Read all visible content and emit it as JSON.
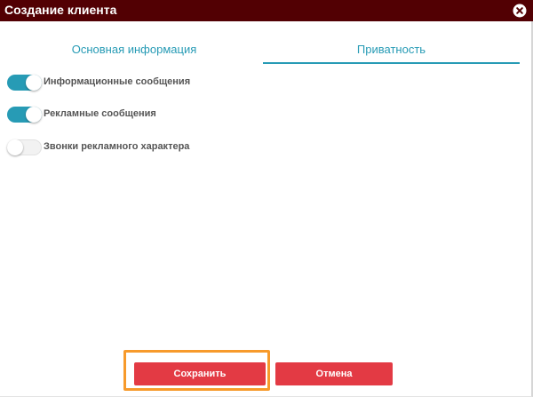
{
  "dialog": {
    "title": "Создание клиента",
    "close_icon": "close-icon",
    "colors": {
      "titlebar": "#520003",
      "accent": "#279bb5",
      "button": "#e33a44",
      "highlight": "#f79a2b"
    }
  },
  "tabs": [
    {
      "label": "Основная информация",
      "active": false
    },
    {
      "label": "Приватность",
      "active": true
    }
  ],
  "privacy": {
    "toggles": [
      {
        "label": "Информационные сообщения",
        "on": true
      },
      {
        "label": "Рекламные сообщения",
        "on": true
      },
      {
        "label": "Звонки рекламного характера",
        "on": false
      }
    ]
  },
  "buttons": {
    "save_label": "Сохранить",
    "cancel_label": "Отмена"
  }
}
